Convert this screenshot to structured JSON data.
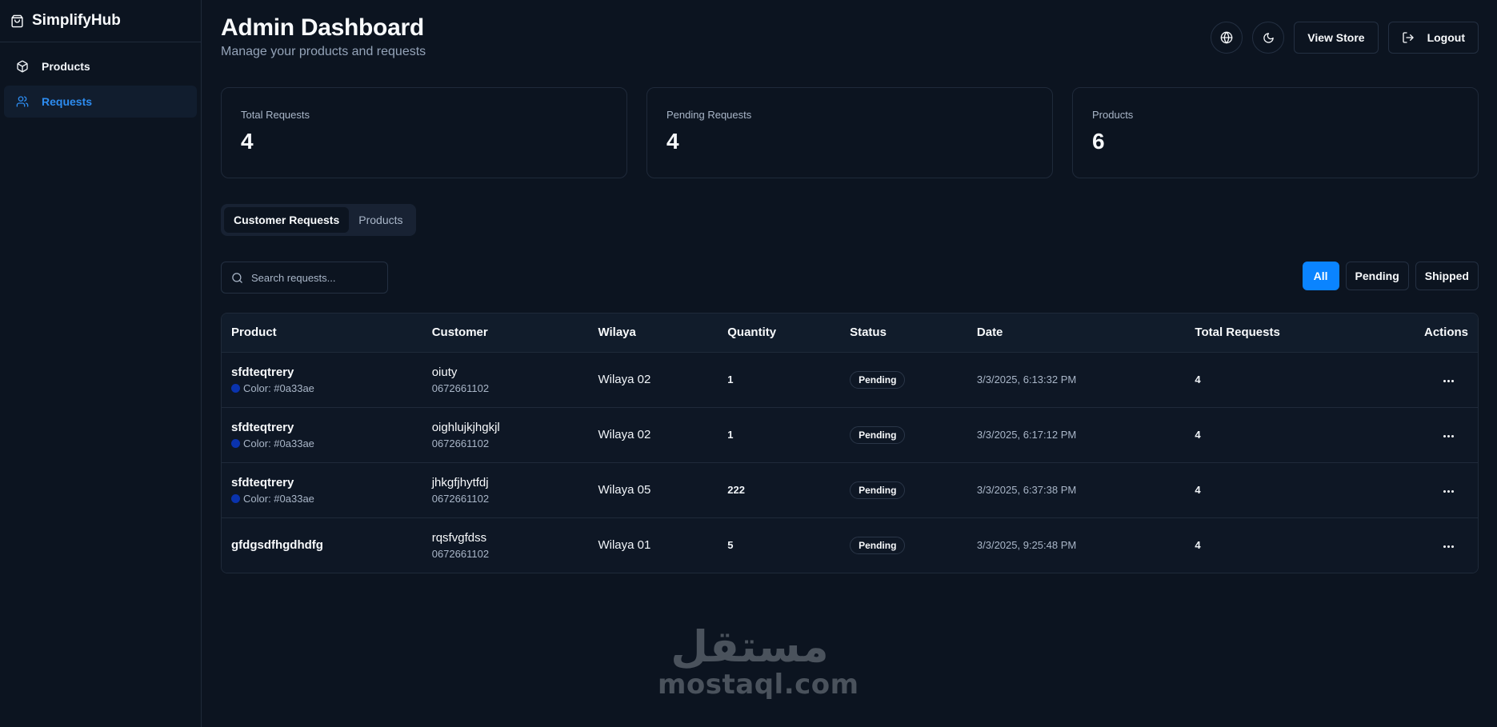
{
  "brand": {
    "name": "SimplifyHub"
  },
  "sidebar": {
    "items": [
      {
        "label": "Products",
        "icon": "box-icon",
        "active": false
      },
      {
        "label": "Requests",
        "icon": "users-icon",
        "active": true
      }
    ]
  },
  "header": {
    "title": "Admin Dashboard",
    "subtitle": "Manage your products and requests",
    "view_store_label": "View Store",
    "logout_label": "Logout"
  },
  "stats": [
    {
      "label": "Total Requests",
      "value": "4"
    },
    {
      "label": "Pending Requests",
      "value": "4"
    },
    {
      "label": "Products",
      "value": "6"
    }
  ],
  "tabs": [
    {
      "label": "Customer Requests",
      "active": true
    },
    {
      "label": "Products",
      "active": false
    }
  ],
  "search": {
    "placeholder": "Search requests...",
    "value": ""
  },
  "filters": [
    {
      "label": "All",
      "active": true
    },
    {
      "label": "Pending",
      "active": false
    },
    {
      "label": "Shipped",
      "active": false
    }
  ],
  "table": {
    "columns": [
      "Product",
      "Customer",
      "Wilaya",
      "Quantity",
      "Status",
      "Date",
      "Total Requests",
      "Actions"
    ],
    "rows": [
      {
        "product": "sfdteqtrery",
        "color_label": "Color: #0a33ae",
        "color": "#0a33ae",
        "customer": "oiuty",
        "phone": "0672661102",
        "wilaya": "Wilaya 02",
        "quantity": "1",
        "status": "Pending",
        "date": "3/3/2025, 6:13:32 PM",
        "total": "4"
      },
      {
        "product": "sfdteqtrery",
        "color_label": "Color: #0a33ae",
        "color": "#0a33ae",
        "customer": "oighlujkjhgkjl",
        "phone": "0672661102",
        "wilaya": "Wilaya 02",
        "quantity": "1",
        "status": "Pending",
        "date": "3/3/2025, 6:17:12 PM",
        "total": "4"
      },
      {
        "product": "sfdteqtrery",
        "color_label": "Color: #0a33ae",
        "color": "#0a33ae",
        "customer": "jhkgfjhytfdj",
        "phone": "0672661102",
        "wilaya": "Wilaya 05",
        "quantity": "222",
        "status": "Pending",
        "date": "3/3/2025, 6:37:38 PM",
        "total": "4"
      },
      {
        "product": "gfdgsdfhgdhdfg",
        "color_label": "",
        "color": "",
        "customer": "rqsfvgfdss",
        "phone": "0672661102",
        "wilaya": "Wilaya 01",
        "quantity": "5",
        "status": "Pending",
        "date": "3/3/2025, 9:25:48 PM",
        "total": "4"
      }
    ]
  },
  "watermark": {
    "arabic": "مستقل",
    "latin": "mostaql.com"
  },
  "colors": {
    "accent": "#0a84ff",
    "background": "#0c1420",
    "active_nav": "#2d8cf0"
  }
}
